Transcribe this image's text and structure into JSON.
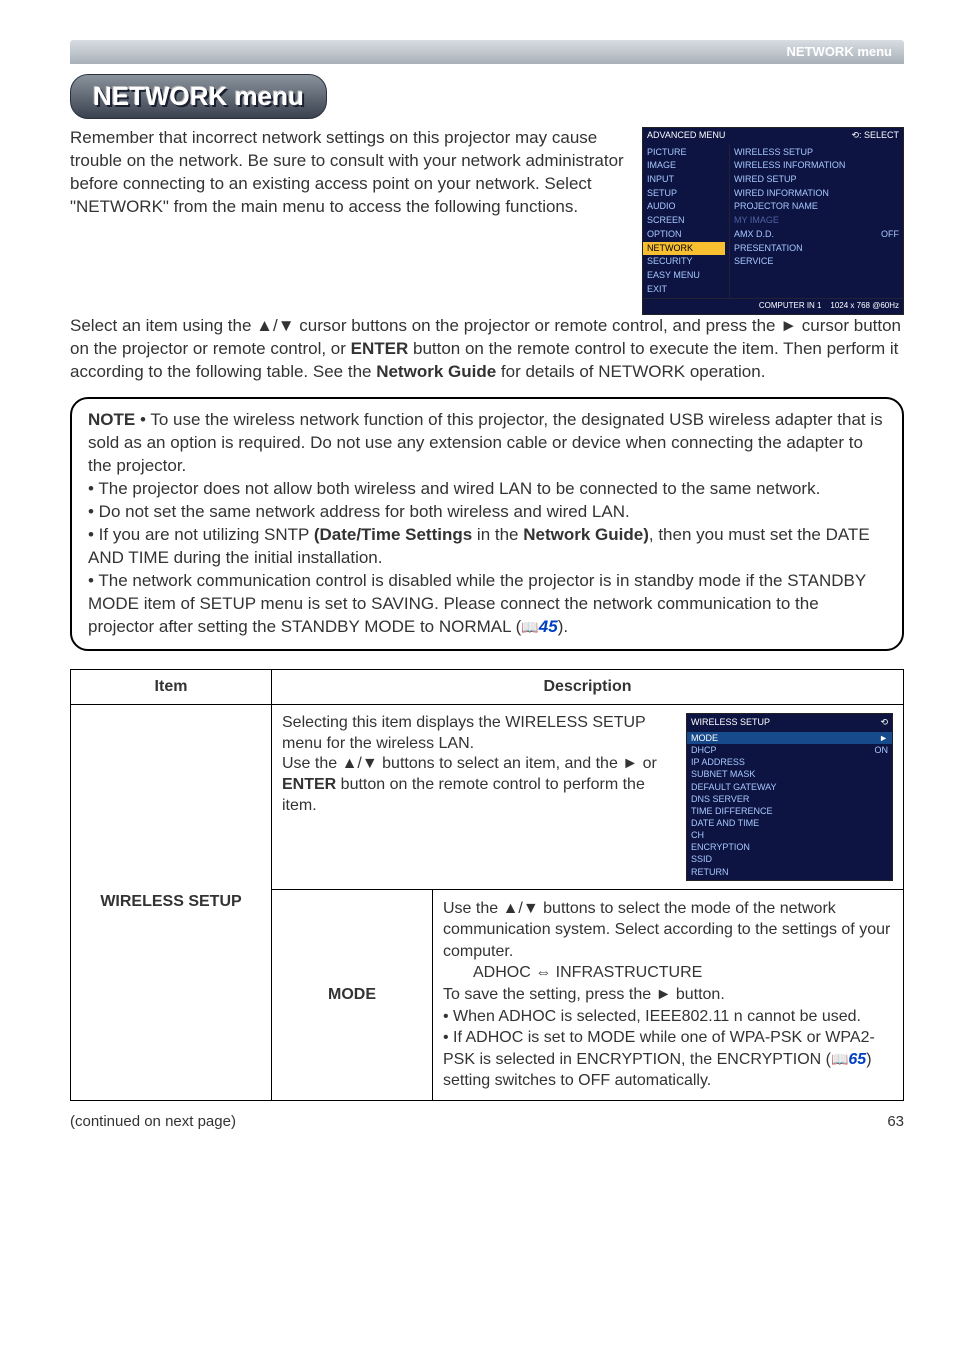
{
  "topbar": {
    "label": "NETWORK menu"
  },
  "pill": "NETWORK menu",
  "intro1": "Remember that incorrect network settings on this projector may cause trouble on the network. Be sure to consult with your network administrator before connecting to an existing access point on your network. Select \"NETWORK\" from the main menu to access the following functions.",
  "intro2a": "Select an item using the ▲/▼ cursor buttons on the projector or remote control, and press the ► cursor button on the projector or remote control, or ",
  "intro2b": "ENTER",
  "intro2c": " button on the remote control to execute the item. Then perform it according to the following table. See the ",
  "intro2d": "Network Guide",
  "intro2e": " for details of NETWORK operation.",
  "osd1": {
    "header_l": "ADVANCED MENU",
    "header_r": "⟲: SELECT",
    "left": [
      "PICTURE",
      "IMAGE",
      "INPUT",
      "SETUP",
      "AUDIO",
      "SCREEN",
      "OPTION",
      "NETWORK",
      "SECURITY",
      "EASY MENU",
      "EXIT"
    ],
    "right": [
      {
        "l": "WIRELESS SETUP"
      },
      {
        "l": "WIRELESS INFORMATION"
      },
      {
        "l": "WIRED SETUP"
      },
      {
        "l": "WIRED INFORMATION"
      },
      {
        "l": "PROJECTOR NAME"
      },
      {
        "l": "MY IMAGE",
        "dim": true
      },
      {
        "l": "AMX D.D.",
        "r": "OFF"
      },
      {
        "l": "PRESENTATION"
      },
      {
        "l": "SERVICE"
      }
    ],
    "footer_l": "COMPUTER IN 1",
    "footer_r": "1024 x 768 @60Hz"
  },
  "note": {
    "label": "NOTE",
    "l1": "  • To use the wireless network function of this projector, the designated USB wireless adapter that is sold as an option is required. Do not use any extension cable or device when connecting the adapter to the projector.",
    "l2": "• The projector does not allow both wireless and wired LAN to be connected to the same network.",
    "l3": "• Do not set the same network address for both wireless and wired LAN.",
    "l4a": "• If you are not utilizing SNTP ",
    "l4b": "(Date/Time Settings",
    "l4c": " in the ",
    "l4d": "Network Guide)",
    "l4e": ", then you must set the DATE AND TIME during the initial installation.",
    "l5a": "• The network communication control is disabled while the projector is in standby mode if the STANDBY MODE item of SETUP menu is set to SAVING. Please connect the network communication to the projector after setting the STANDBY MODE to NORMAL (",
    "l5b": "45",
    "l5c": ")."
  },
  "table": {
    "h1": "Item",
    "h2": "Description",
    "wireless_label": "WIRELESS SETUP",
    "r1_text_a": "Selecting this item displays the WIRELESS SETUP menu for the wireless LAN.",
    "r1_text_b": "Use the ▲/▼ buttons to select an item, and the ► or ",
    "r1_text_c": "ENTER",
    "r1_text_d": " button on the remote control to perform the item.",
    "mode_label": "MODE",
    "mode_a": "Use the ▲/▼ buttons to select the mode of the network communication system. Select according to the settings of your computer.",
    "mode_b": "ADHOC ⇔ INFRASTRUCTURE",
    "mode_c": "To save the setting, press the ► button.",
    "mode_d": "• When ADHOC is selected, IEEE802.11 n cannot be used.",
    "mode_e1": "• If ADHOC is set to MODE while one of WPA-PSK or WPA2-PSK is selected in ENCRYPTION, the ENCRYPTION (",
    "mode_e2": "65",
    "mode_e3": ") setting switches to OFF automatically."
  },
  "osd2": {
    "title": "WIRELESS SETUP",
    "items": [
      {
        "l": "MODE",
        "sel": true,
        "r": ""
      },
      {
        "l": "DHCP",
        "r": "ON"
      },
      {
        "l": "IP ADDRESS"
      },
      {
        "l": "SUBNET MASK"
      },
      {
        "l": "DEFAULT GATEWAY"
      },
      {
        "l": "DNS SERVER"
      },
      {
        "l": "TIME DIFFERENCE"
      },
      {
        "l": "DATE AND TIME"
      },
      {
        "l": "CH"
      },
      {
        "l": "ENCRYPTION"
      },
      {
        "l": "SSID"
      },
      {
        "l": "RETURN"
      }
    ]
  },
  "footer": {
    "cont": "(continued on next page)",
    "page": "63"
  }
}
